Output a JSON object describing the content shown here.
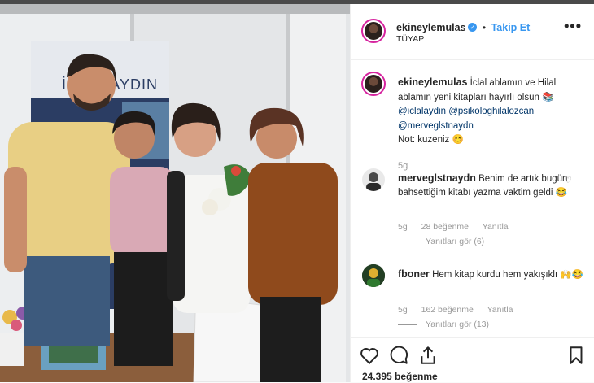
{
  "post": {
    "username": "ekineylemulas",
    "follow_label": "Takip Et",
    "location": "TÜYAP",
    "more_label": "•••",
    "caption": {
      "username": "ekineylemulas",
      "text": "İclal ablamın ve Hilal ablamın yeni kitapları hayırlı olsun",
      "mentions": [
        "@iclalaydin",
        "@psikologhilalozcan",
        "@merveglstnaydn"
      ],
      "note": "Not: kuzeniz",
      "time": "5g"
    },
    "comments": [
      {
        "username": "merveglstnaydn",
        "text": "Benim de artık bugün bahsettiğim kitabı yazma vaktim geldi",
        "time": "5g",
        "likes": "28 beğenme",
        "reply_label": "Yanıtla",
        "view_replies": "Yanıtları gör (6)"
      },
      {
        "username": "fboner",
        "text": "Hem kitap kurdu hem yakışıklı",
        "time": "5g",
        "likes": "162 beğenme",
        "reply_label": "Yanıtla",
        "view_replies": "Yanıtları gör (13)"
      }
    ],
    "likes_count": "24.395 beğenme"
  },
  "photo": {
    "banner_text": "İCLAL AYDIN"
  },
  "colors": {
    "accent": "#3897f0",
    "text": "#262626",
    "muted": "#999999",
    "mention": "#003569"
  },
  "icons": [
    "verified-icon",
    "more-icon",
    "heart-icon",
    "comment-icon",
    "share-icon",
    "bookmark-icon"
  ]
}
